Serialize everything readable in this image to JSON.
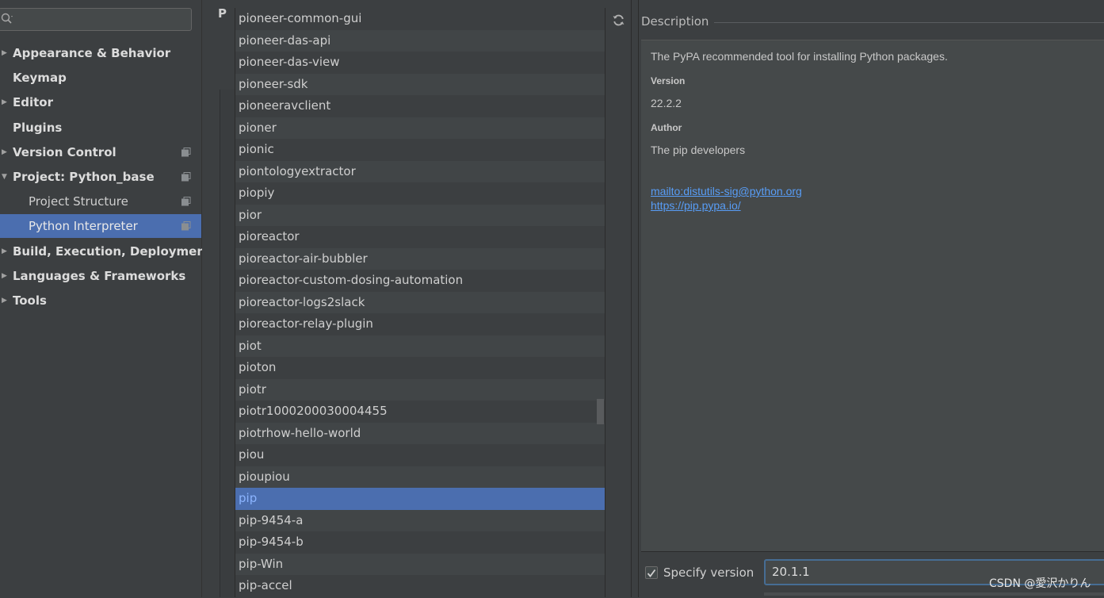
{
  "sidebar": {
    "search": {
      "placeholder": ""
    },
    "items": [
      {
        "label": "Appearance & Behavior",
        "has_arrow": true
      },
      {
        "label": "Keymap"
      },
      {
        "label": "Editor",
        "has_arrow": true
      },
      {
        "label": "Plugins"
      },
      {
        "label": "Version Control",
        "has_arrow": true,
        "copy_icon": true
      },
      {
        "label": "Project: Python_base",
        "expanded": true,
        "copy_icon": true
      },
      {
        "label": "Project Structure",
        "child": true,
        "copy_icon": true
      },
      {
        "label": "Python Interpreter",
        "child": true,
        "selected": true,
        "copy_icon": true
      },
      {
        "label": "Build, Execution, Deployment",
        "has_arrow": true
      },
      {
        "label": "Languages & Frameworks",
        "has_arrow": true
      },
      {
        "label": "Tools",
        "has_arrow": true
      }
    ]
  },
  "page_letter": "P",
  "packages": [
    "pioneer-common-gui",
    "pioneer-das-api",
    "pioneer-das-view",
    "pioneer-sdk",
    "pioneeravclient",
    "pioner",
    "pionic",
    "piontologyextractor",
    "piopiy",
    "pior",
    "pioreactor",
    "pioreactor-air-bubbler",
    "pioreactor-custom-dosing-automation",
    "pioreactor-logs2slack",
    "pioreactor-relay-plugin",
    "piot",
    "pioton",
    "piotr",
    "piotr1000200030004455",
    "piotrhow-hello-world",
    "piou",
    "pioupiou",
    "pip",
    "pip-9454-a",
    "pip-9454-b",
    "pip-Win",
    "pip-accel"
  ],
  "selected_package": "pip",
  "description": {
    "title": "Description",
    "summary": "The PyPA recommended tool for installing Python packages.",
    "version_label": "Version",
    "version_value": "22.2.2",
    "author_label": "Author",
    "author_value": "The pip developers",
    "link_email": "mailto:distutils-sig@python.org",
    "link_home": "https://pip.pypa.io/"
  },
  "specify_version": {
    "label": "Specify version",
    "checked": true,
    "value": "20.1.1"
  },
  "watermark": "CSDN @愛沢かりん",
  "colors": {
    "background": "#3c3f41",
    "selection": "#4b6eaf",
    "link": "#589df6"
  }
}
